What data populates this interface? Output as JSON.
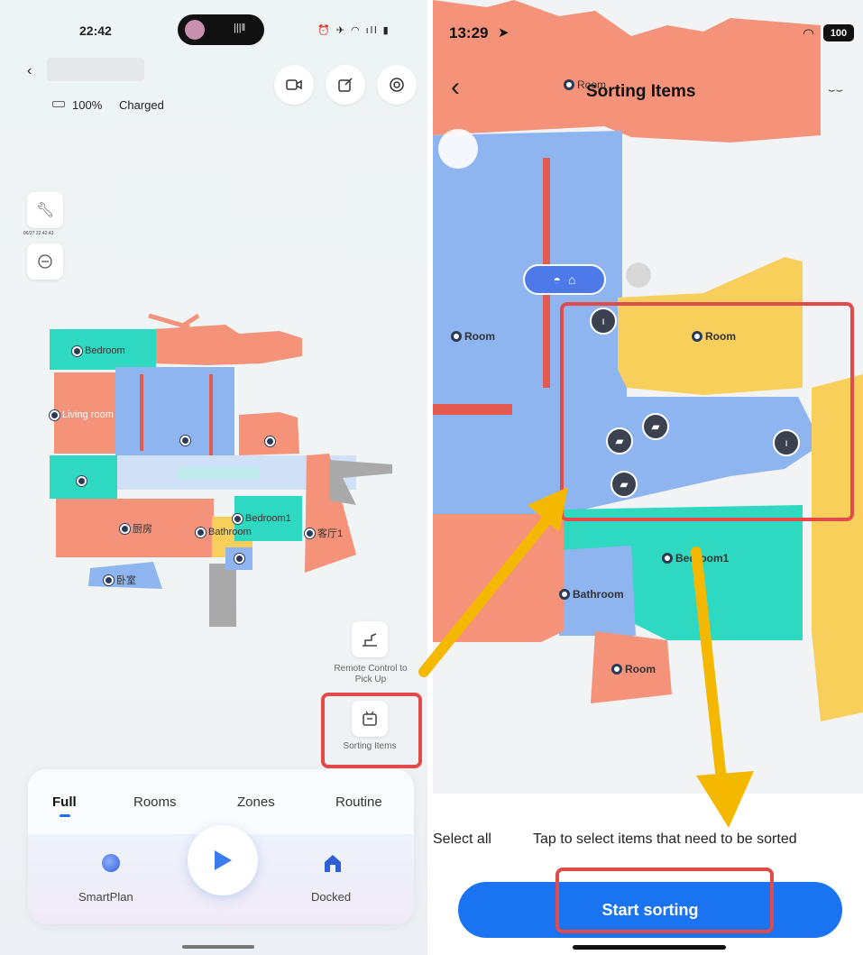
{
  "left": {
    "status_bar": {
      "time": "22:42"
    },
    "battery": {
      "percent": "100%",
      "status": "Charged"
    },
    "side": {
      "timestamp": "06/27 22:42:43"
    },
    "rooms": [
      "Bedroom",
      "Living room",
      "Bedroom1",
      "Bathroom",
      "厨房",
      "客厅1",
      "卧室"
    ],
    "actions": {
      "remote_control": "Remote Control to Pick Up",
      "sorting_items": "Sorting Items"
    },
    "tabs": [
      "Full",
      "Rooms",
      "Zones",
      "Routine"
    ],
    "controls": {
      "smartplan": "SmartPlan",
      "docked": "Docked"
    }
  },
  "right": {
    "status_bar": {
      "time": "13:29",
      "battery": "100"
    },
    "title": "Sorting Items",
    "rooms": [
      "Room",
      "Room",
      "Room",
      "Bedroom1",
      "Bathroom",
      "Room"
    ],
    "select_all": "Select all",
    "hint": "Tap to select items that need to be sorted",
    "start_button": "Start sorting"
  },
  "colors": {
    "blue_room": "#8fb5f0",
    "salmon_room": "#f4927a",
    "yellow_room": "#f7cf5a",
    "teal_room": "#2fd8c0",
    "accent_blue": "#1a73f0",
    "highlight_red": "#e34a4a",
    "arrow_yellow": "#f5b800"
  }
}
